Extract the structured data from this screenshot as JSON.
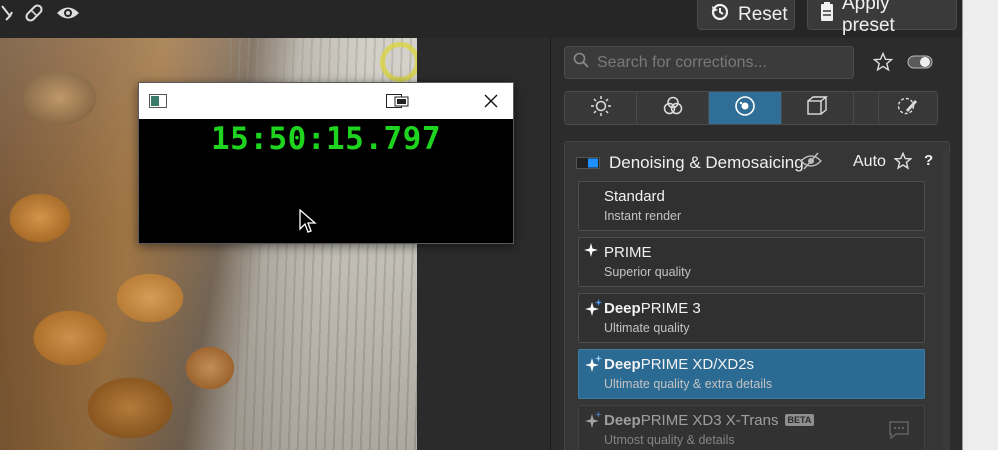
{
  "toolbar": {
    "icons": [
      "crop-icon",
      "healing-icon",
      "preview-icon"
    ],
    "reset_label": "Reset",
    "apply_preset_label": "Apply preset"
  },
  "clock_window": {
    "time": "15:50:15.797"
  },
  "panel": {
    "search": {
      "placeholder": "Search for corrections..."
    },
    "tabs": [
      {
        "icon": "light-icon",
        "active": false
      },
      {
        "icon": "color-icon",
        "active": false
      },
      {
        "icon": "detail-icon",
        "active": true
      },
      {
        "icon": "geometry-icon",
        "active": false
      },
      {
        "icon": "effects-icon",
        "active": false
      }
    ],
    "module": {
      "title": "Denoising & Demosaicing",
      "auto_label": "Auto",
      "help_label": "?",
      "options": [
        {
          "name_bold": "",
          "name": "Standard",
          "sub": "Instant render",
          "icon": "",
          "selected": false
        },
        {
          "name_bold": "",
          "name": "PRIME",
          "sub": "Superior quality",
          "icon": "sparkle-icon",
          "selected": false
        },
        {
          "name_bold": "Deep",
          "name": "PRIME 3",
          "sub": "Ultimate quality",
          "icon": "sparkles-icon",
          "selected": false
        },
        {
          "name_bold": "Deep",
          "name": "PRIME XD/XD2s",
          "sub": "Ultimate quality & extra details",
          "icon": "sparkles-icon",
          "selected": true
        },
        {
          "name_bold": "Deep",
          "name": "PRIME XD3 X-Trans",
          "badge": "BETA",
          "sub": "Utmost quality & details",
          "icon": "sparkles-icon",
          "selected": false
        }
      ]
    }
  },
  "colors": {
    "accent": "#2f6f97",
    "selected_option": "#2b6a92",
    "clock_text": "#1ed41e"
  }
}
